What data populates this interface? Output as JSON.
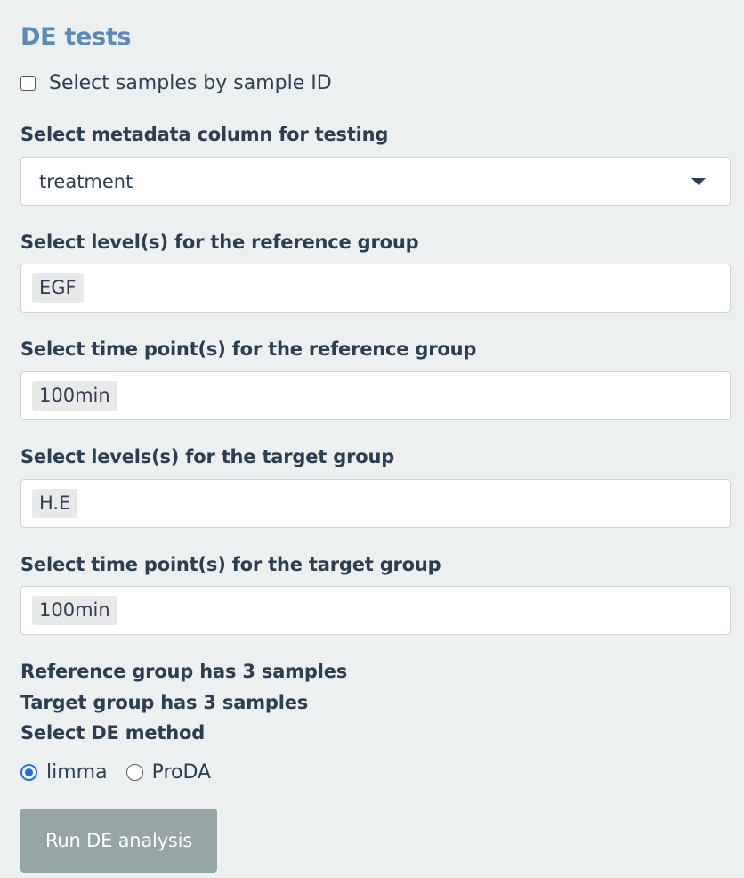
{
  "title": "DE tests",
  "select_by_id": {
    "label": "Select samples by sample ID",
    "checked": false
  },
  "metadata_column": {
    "label": "Select metadata column for testing",
    "value": "treatment"
  },
  "reference_levels": {
    "label": "Select level(s) for the reference group",
    "chips": [
      "EGF"
    ]
  },
  "reference_timepoints": {
    "label": "Select time point(s) for the reference group",
    "chips": [
      "100min"
    ]
  },
  "target_levels": {
    "label": "Select levels(s) for the target group",
    "chips": [
      "H.E"
    ]
  },
  "target_timepoints": {
    "label": "Select time point(s) for the target group",
    "chips": [
      "100min"
    ]
  },
  "status": {
    "reference_count": "Reference group has 3 samples",
    "target_count": "Target group has 3 samples"
  },
  "de_method": {
    "label": "Select DE method",
    "options": [
      "limma",
      "ProDA"
    ],
    "selected": "limma"
  },
  "run_button": {
    "label": "Run DE analysis"
  },
  "colors": {
    "title": "#5b8ab8",
    "text": "#2c3e50",
    "background": "#ecf0f1",
    "button": "#95a5a6",
    "radio_accent": "#1f6feb"
  }
}
